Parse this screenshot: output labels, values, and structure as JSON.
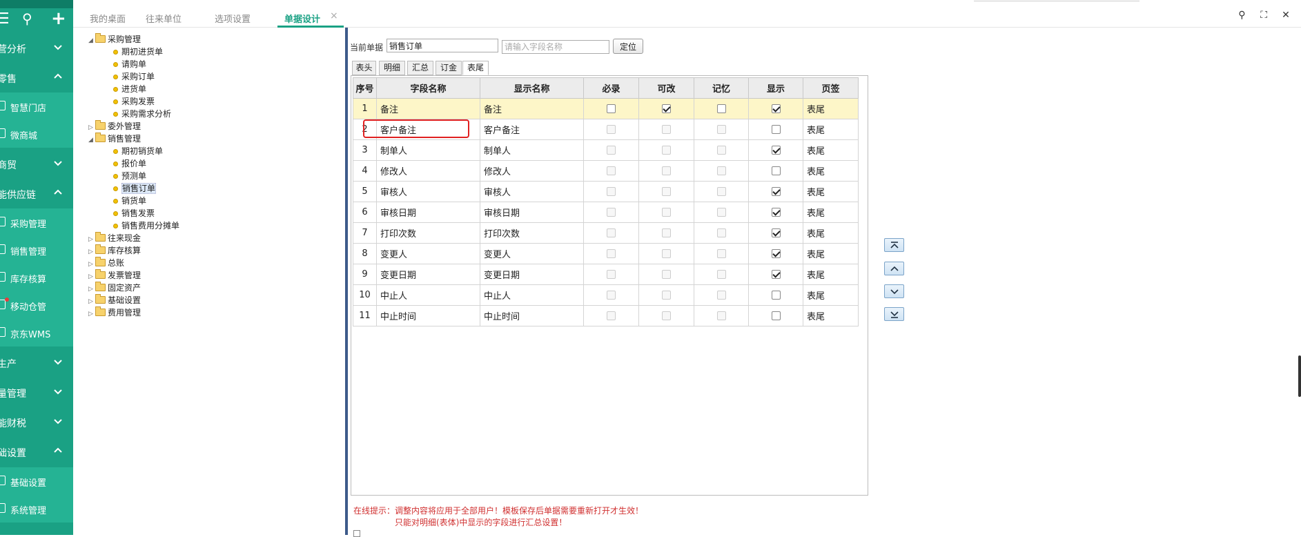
{
  "sidebar": {
    "tools": {
      "menu": "☰",
      "search": "⚲",
      "add": "+"
    },
    "items": [
      {
        "label": "营分析",
        "expanded": false
      },
      {
        "label": "零售",
        "expanded": true
      },
      {
        "label": "智慧门店",
        "sub": true
      },
      {
        "label": "微商城",
        "sub": true
      },
      {
        "label": "商贸",
        "expanded": false
      },
      {
        "label": "能供应链",
        "expanded": true
      },
      {
        "label": "采购管理",
        "sub": true
      },
      {
        "label": "销售管理",
        "sub": true
      },
      {
        "label": "库存核算",
        "sub": true
      },
      {
        "label": "移动仓管",
        "sub": true,
        "dot": true
      },
      {
        "label": "京东WMS",
        "sub": true
      },
      {
        "label": "生产",
        "expanded": false
      },
      {
        "label": "量管理",
        "expanded": false
      },
      {
        "label": "能财税",
        "expanded": false
      },
      {
        "label": "础设置",
        "expanded": true
      },
      {
        "label": "基础设置",
        "sub": true
      },
      {
        "label": "系统管理",
        "sub": true
      }
    ]
  },
  "tabs": [
    "我的桌面",
    "往来单位",
    "选项设置",
    "单据设计"
  ],
  "active_tab": "单据设计",
  "tab_close": "×",
  "top_icons": {
    "search": "⚲",
    "fullscreen": "⛶",
    "close": "✕"
  },
  "tree": [
    {
      "label": "采购管理",
      "level": 0,
      "type": "folder",
      "open": true
    },
    {
      "label": "期初进货单",
      "level": 1,
      "type": "leaf"
    },
    {
      "label": "请购单",
      "level": 1,
      "type": "leaf"
    },
    {
      "label": "采购订单",
      "level": 1,
      "type": "leaf"
    },
    {
      "label": "进货单",
      "level": 1,
      "type": "leaf"
    },
    {
      "label": "采购发票",
      "level": 1,
      "type": "leaf"
    },
    {
      "label": "采购需求分析",
      "level": 1,
      "type": "leaf"
    },
    {
      "label": "委外管理",
      "level": 0,
      "type": "folder",
      "open": false
    },
    {
      "label": "销售管理",
      "level": 0,
      "type": "folder",
      "open": true
    },
    {
      "label": "期初销货单",
      "level": 1,
      "type": "leaf"
    },
    {
      "label": "报价单",
      "level": 1,
      "type": "leaf"
    },
    {
      "label": "预测单",
      "level": 1,
      "type": "leaf"
    },
    {
      "label": "销售订单",
      "level": 1,
      "type": "leaf",
      "selected": true
    },
    {
      "label": "销货单",
      "level": 1,
      "type": "leaf"
    },
    {
      "label": "销售发票",
      "level": 1,
      "type": "leaf"
    },
    {
      "label": "销售费用分摊单",
      "level": 1,
      "type": "leaf"
    },
    {
      "label": "往来现金",
      "level": 0,
      "type": "folder",
      "open": false
    },
    {
      "label": "库存核算",
      "level": 0,
      "type": "folder",
      "open": false
    },
    {
      "label": "总账",
      "level": 0,
      "type": "folder",
      "open": false
    },
    {
      "label": "发票管理",
      "level": 0,
      "type": "folder",
      "open": false
    },
    {
      "label": "固定资产",
      "level": 0,
      "type": "folder",
      "open": false
    },
    {
      "label": "基础设置",
      "level": 0,
      "type": "folder",
      "open": false
    },
    {
      "label": "费用管理",
      "level": 0,
      "type": "folder",
      "open": false
    }
  ],
  "form": {
    "current_label": "当前单据",
    "current_value": "销售订单",
    "field_search_placeholder": "请输入字段名称",
    "locate_button": "定位"
  },
  "subtabs": [
    "表头",
    "明细",
    "汇总",
    "订金",
    "表尾"
  ],
  "active_subtab": "表尾",
  "grid": {
    "headers": [
      "序号",
      "字段名称",
      "显示名称",
      "必录",
      "可改",
      "记忆",
      "显示",
      "页签"
    ],
    "rows": [
      {
        "no": "1",
        "field": "备注",
        "display": "备注",
        "required": false,
        "editable": true,
        "memory": false,
        "show": true,
        "page": "表尾",
        "highlight": true,
        "disabled": false
      },
      {
        "no": "2",
        "field": "客户备注",
        "display": "客户备注",
        "required": false,
        "editable": false,
        "memory": false,
        "show": false,
        "page": "表尾",
        "disabled": true
      },
      {
        "no": "3",
        "field": "制单人",
        "display": "制单人",
        "required": false,
        "editable": false,
        "memory": false,
        "show": true,
        "page": "表尾",
        "disabled": true
      },
      {
        "no": "4",
        "field": "修改人",
        "display": "修改人",
        "required": false,
        "editable": false,
        "memory": false,
        "show": false,
        "page": "表尾",
        "disabled": true
      },
      {
        "no": "5",
        "field": "审核人",
        "display": "审核人",
        "required": false,
        "editable": false,
        "memory": false,
        "show": true,
        "page": "表尾",
        "disabled": true
      },
      {
        "no": "6",
        "field": "审核日期",
        "display": "审核日期",
        "required": false,
        "editable": false,
        "memory": false,
        "show": true,
        "page": "表尾",
        "disabled": true
      },
      {
        "no": "7",
        "field": "打印次数",
        "display": "打印次数",
        "required": false,
        "editable": false,
        "memory": false,
        "show": true,
        "page": "表尾",
        "disabled": true
      },
      {
        "no": "8",
        "field": "变更人",
        "display": "变更人",
        "required": false,
        "editable": false,
        "memory": false,
        "show": true,
        "page": "表尾",
        "disabled": true
      },
      {
        "no": "9",
        "field": "变更日期",
        "display": "变更日期",
        "required": false,
        "editable": false,
        "memory": false,
        "show": true,
        "page": "表尾",
        "disabled": true
      },
      {
        "no": "10",
        "field": "中止人",
        "display": "中止人",
        "required": false,
        "editable": false,
        "memory": false,
        "show": false,
        "page": "表尾",
        "disabled": true
      },
      {
        "no": "11",
        "field": "中止时间",
        "display": "中止时间",
        "required": false,
        "editable": false,
        "memory": false,
        "show": false,
        "page": "表尾",
        "disabled": true
      }
    ]
  },
  "tips": {
    "line1": "在线提示：调整内容将应用于全部用户！模板保存后单据需要重新打开才生效！",
    "line2": "只能对明细(表体)中显示的字段进行汇总设置！"
  },
  "colors": {
    "sidebar": "#1aa184",
    "accent": "#1aa184",
    "highlight_row": "#fdf6c8",
    "tip_text": "#d03030",
    "annotation_box": "#e02020"
  }
}
